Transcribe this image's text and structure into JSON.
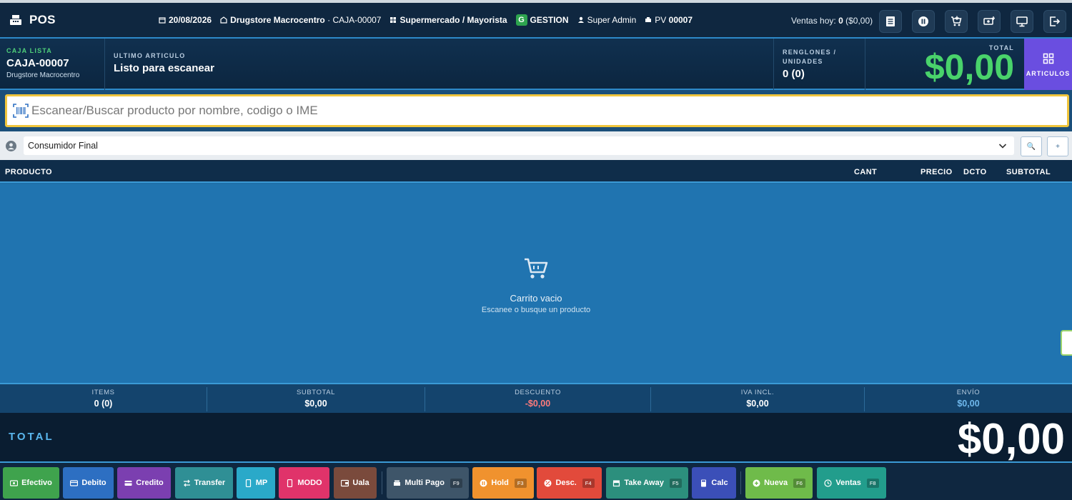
{
  "header": {
    "app_title": "POS",
    "date": "20/08/2026",
    "store": "Drugstore Macrocentro",
    "caja_code": "· CAJA-00007",
    "mode": "Supermercado / Mayorista",
    "gestion_badge": "G",
    "gestion_label": "GESTION",
    "user": "Super Admin",
    "pv_label": "PV",
    "pv_value": "00007",
    "ventas_label": "Ventas hoy:",
    "ventas_count": "0",
    "ventas_amount": "($0,00)",
    "icons": [
      "list-icon",
      "pause-icon",
      "cart-add-icon",
      "cash-add-icon",
      "monitor-icon",
      "logout-icon"
    ]
  },
  "info": {
    "caja_status": "CAJA LISTA",
    "caja_name": "CAJA-00007",
    "caja_store": "Drugstore Macrocentro",
    "last_item_label": "ULTIMO ARTICULO",
    "last_item_value": "Listo para escanear",
    "renglones_label": "RENGLONES / UNIDADES",
    "renglones_value": "0 (0)",
    "total_label": "TOTAL",
    "total_value": "$0,00",
    "articulos_label": "ARTICULOS"
  },
  "search": {
    "placeholder": "Escanear/Buscar producto por nombre, codigo o IME"
  },
  "customer": {
    "selected": "Consumidor Final",
    "search_btn": "🔍",
    "add_btn": "+"
  },
  "table": {
    "headers": {
      "product": "PRODUCTO",
      "qty": "CANT",
      "price": "PRECIO",
      "discount": "DCTO",
      "subtotal": "SUBTOTAL"
    }
  },
  "cart": {
    "empty_title": "Carrito vacio",
    "empty_subtitle": "Escanee o busque un producto"
  },
  "summary": {
    "items_label": "ITEMS",
    "items_value": "0 (0)",
    "subtotal_label": "SUBTOTAL",
    "subtotal_value": "$0,00",
    "discount_label": "DESCUENTO",
    "discount_value": "-$0,00",
    "iva_label": "IVA INCL.",
    "iva_value": "$0,00",
    "envio_label": "ENVÍO",
    "envio_value": "$0,00"
  },
  "grand_total": {
    "label": "TOTAL",
    "value": "$0,00"
  },
  "actions": {
    "efectivo": "Efectivo",
    "debito": "Debito",
    "credito": "Credito",
    "transfer": "Transfer",
    "mp": "MP",
    "modo": "MODO",
    "uala": "Uala",
    "multipago": "Multi Pago",
    "multipago_key": "F9",
    "hold": "Hold",
    "hold_key": "F3",
    "desc": "Desc.",
    "desc_key": "F4",
    "takeaway": "Take Away",
    "takeaway_key": "F5",
    "calc": "Calc",
    "nueva": "Nueva",
    "nueva_key": "F6",
    "ventas": "Ventas",
    "ventas_key": "F8"
  },
  "colors": {
    "accent_green": "#49d36b",
    "articulos_purple": "#6a4ee0",
    "search_border": "#f0c53c",
    "efectivo": "#3fa34d",
    "debito": "#2d6fc2",
    "credito": "#7b3fb0",
    "transfer": "#2f8f95",
    "mp": "#2aa9c9",
    "modo": "#e0336a",
    "uala": "#7a4a3c",
    "multipago": "#3e5569",
    "hold": "#f0922e",
    "desc": "#e24a3b",
    "takeaway": "#2c8f7d",
    "calc": "#3b4fb8",
    "nueva": "#6fbb4a",
    "ventas": "#229d8c"
  }
}
